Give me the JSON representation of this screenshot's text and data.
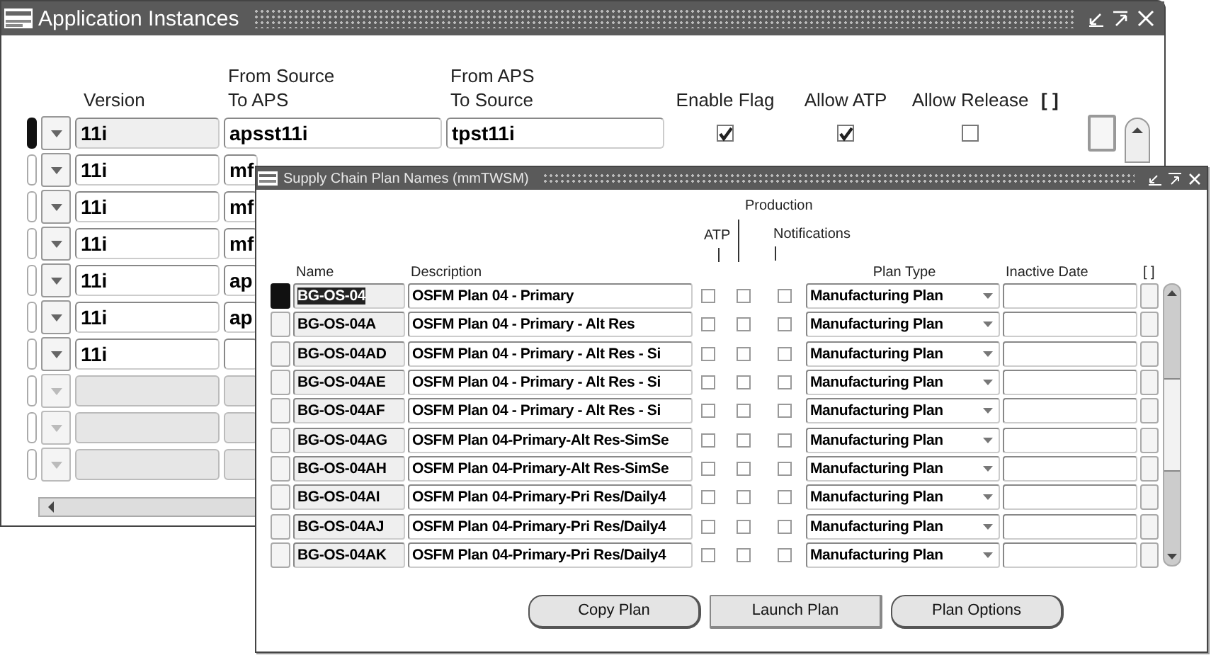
{
  "back_window": {
    "title": "Application Instances",
    "columns": [
      {
        "lines": [
          "Version"
        ]
      },
      {
        "lines": [
          "From Source",
          "To APS"
        ]
      },
      {
        "lines": [
          "From APS",
          "To Source"
        ]
      },
      {
        "lines": [
          "Enable Flag"
        ]
      },
      {
        "lines": [
          "Allow ATP"
        ]
      },
      {
        "lines": [
          "Allow Release"
        ]
      },
      {
        "lines": [
          "[ ]"
        ]
      }
    ],
    "rows": [
      {
        "current": true,
        "disabled": false,
        "version": "11i",
        "source": "apsst11i",
        "target": "tpst11i",
        "enable_flag": true,
        "allow_atp": true,
        "allow_release": false
      },
      {
        "current": false,
        "disabled": false,
        "version": "11i",
        "source": "mf"
      },
      {
        "current": false,
        "disabled": false,
        "version": "11i",
        "source": "mf"
      },
      {
        "current": false,
        "disabled": false,
        "version": "11i",
        "source": "mf"
      },
      {
        "current": false,
        "disabled": false,
        "version": "11i",
        "source": "ap"
      },
      {
        "current": false,
        "disabled": false,
        "version": "11i",
        "source": "ap"
      },
      {
        "current": false,
        "disabled": false,
        "version": "11i"
      },
      {
        "current": false,
        "disabled": true
      },
      {
        "current": false,
        "disabled": true
      },
      {
        "current": false,
        "disabled": true
      }
    ]
  },
  "front_window": {
    "title": "Supply Chain Plan Names (mmTWSM)",
    "columns": {
      "name": "Name",
      "description": "Description",
      "atp": "ATP",
      "production": "Production",
      "notifications": "Notifications",
      "plan_type": "Plan Type",
      "inactive_date": "Inactive Date",
      "extra": "[ ]"
    },
    "rows": [
      {
        "current": true,
        "name": "BG-OS-04",
        "description": "OSFM Plan 04 - Primary",
        "atp": false,
        "production": false,
        "notifications": false,
        "plan_type": "Manufacturing Plan"
      },
      {
        "current": false,
        "name": "BG-OS-04A",
        "description": "OSFM Plan 04 - Primary - Alt Res",
        "atp": false,
        "production": false,
        "notifications": false,
        "plan_type": "Manufacturing Plan"
      },
      {
        "current": false,
        "name": "BG-OS-04AD",
        "description": "OSFM Plan 04 - Primary - Alt Res - Si",
        "atp": false,
        "production": false,
        "notifications": false,
        "plan_type": "Manufacturing Plan"
      },
      {
        "current": false,
        "name": "BG-OS-04AE",
        "description": "OSFM Plan 04 - Primary - Alt Res - Si",
        "atp": false,
        "production": false,
        "notifications": false,
        "plan_type": "Manufacturing Plan"
      },
      {
        "current": false,
        "name": "BG-OS-04AF",
        "description": "OSFM Plan 04 - Primary - Alt Res - Si",
        "atp": false,
        "production": false,
        "notifications": false,
        "plan_type": "Manufacturing Plan"
      },
      {
        "current": false,
        "name": "BG-OS-04AG",
        "description": "OSFM Plan 04-Primary-Alt Res-SimSe",
        "atp": false,
        "production": false,
        "notifications": false,
        "plan_type": "Manufacturing Plan"
      },
      {
        "current": false,
        "name": "BG-OS-04AH",
        "description": "OSFM Plan 04-Primary-Alt Res-SimSe",
        "atp": false,
        "production": false,
        "notifications": false,
        "plan_type": "Manufacturing Plan"
      },
      {
        "current": false,
        "name": "BG-OS-04AI",
        "description": "OSFM Plan 04-Primary-Pri Res/Daily4",
        "atp": false,
        "production": false,
        "notifications": false,
        "plan_type": "Manufacturing Plan"
      },
      {
        "current": false,
        "name": "BG-OS-04AJ",
        "description": "OSFM Plan 04-Primary-Pri Res/Daily4",
        "atp": false,
        "production": false,
        "notifications": false,
        "plan_type": "Manufacturing Plan"
      },
      {
        "current": false,
        "name": "BG-OS-04AK",
        "description": "OSFM Plan 04-Primary-Pri Res/Daily4",
        "atp": false,
        "production": false,
        "notifications": false,
        "plan_type": "Manufacturing Plan"
      }
    ],
    "buttons": [
      {
        "label": "Copy Plan",
        "kind": "rounded"
      },
      {
        "label": "Launch Plan",
        "kind": "square"
      },
      {
        "label": "Plan Options",
        "kind": "rounded"
      }
    ]
  }
}
